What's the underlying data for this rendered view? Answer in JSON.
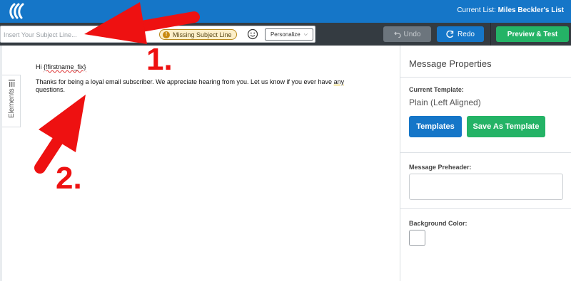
{
  "header": {
    "current_list_prefix": "Current List:",
    "current_list_name": "Miles Beckler's List"
  },
  "toolbar": {
    "subject_placeholder": "Insert Your Subject Line...",
    "missing_subject_badge": "Missing Subject Line",
    "personalize_label": "Personalize",
    "undo_label": "Undo",
    "redo_label": "Redo",
    "preview_label": "Preview & Test"
  },
  "sidebar": {
    "elements_label": "Elements"
  },
  "email": {
    "greeting_prefix": "Hi ",
    "merge_tag": "{!firstname_fix}",
    "body_part1": "Thanks for being a loyal email subscriber. We appreciate hearing from you. Let us know if you ever have ",
    "body_spell_word": "any",
    "body_part2": " questions."
  },
  "panel": {
    "title": "Message Properties",
    "current_template_label": "Current Template:",
    "current_template_value": "Plain (Left Aligned)",
    "templates_button": "Templates",
    "save_template_button": "Save As Template",
    "preheader_label": "Message Preheader:",
    "preheader_value": "",
    "background_color_label": "Background Color:"
  },
  "annotations": {
    "label_1": "1.",
    "label_2": "2."
  },
  "colors": {
    "topbar": "#1576c8",
    "toolbar": "#343b41",
    "primary_blue": "#1576c8",
    "primary_green": "#24b366",
    "annotation_red": "#ee1111",
    "background_color_value": "#ffffff"
  },
  "icons": [
    "logo-icon",
    "warning-icon",
    "emoji-icon",
    "chevron-down-icon",
    "undo-icon",
    "redo-icon",
    "elements-icon"
  ]
}
